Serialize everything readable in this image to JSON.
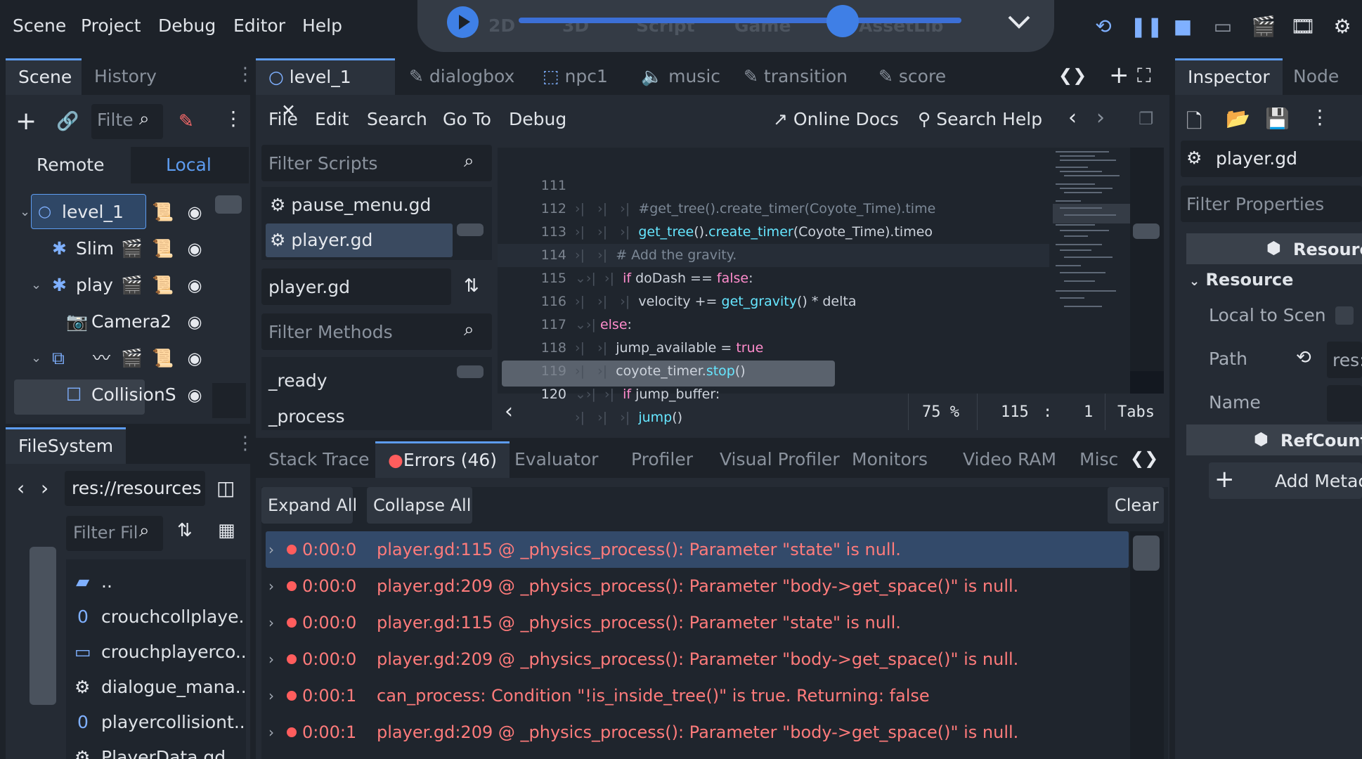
{
  "menu": [
    "Scene",
    "Project",
    "Debug",
    "Editor",
    "Help"
  ],
  "run_bar": {
    "tabs": [
      "2D",
      "3D",
      "Script",
      "Game",
      "AssetLib"
    ]
  },
  "scene_dock": {
    "tabs": [
      "Scene",
      "History"
    ],
    "filter_placeholder": "Filte",
    "remote_label": "Remote",
    "local_label": "Local",
    "nodes": [
      {
        "label": "level_1"
      },
      {
        "label": "Slim"
      },
      {
        "label": "play"
      },
      {
        "label": "Camera2"
      },
      {
        "label": ""
      },
      {
        "label": "CollisionS"
      }
    ]
  },
  "filesystem": {
    "title": "FileSystem",
    "path": "res://resources",
    "filter_placeholder": "Filter Fil",
    "items": [
      "..",
      "crouchcollplaye...",
      "crouchplayerco...",
      "dialogue_mana...",
      "playercollisiont...",
      "PlayerData.gd"
    ]
  },
  "editor_tabs": [
    "level_1",
    "dialogbox",
    "npc1",
    "music",
    "transition",
    "score"
  ],
  "script_menu": [
    "File",
    "Edit",
    "Search",
    "Go To",
    "Debug"
  ],
  "online_docs": "Online Docs",
  "search_help": "Search Help",
  "filter_scripts_placeholder": "Filter Scripts",
  "scripts": [
    "pause_menu.gd",
    "player.gd"
  ],
  "current_script": "player.gd",
  "filter_methods_placeholder": "Filter Methods",
  "methods": [
    "_ready",
    "_process"
  ],
  "code_lines": [
    {
      "n": "111"
    },
    {
      "n": "112"
    },
    {
      "n": "113"
    },
    {
      "n": "114"
    },
    {
      "n": "115"
    },
    {
      "n": "116"
    },
    {
      "n": "117"
    },
    {
      "n": "118"
    },
    {
      "n": "119"
    },
    {
      "n": "120"
    }
  ],
  "status": {
    "zoom": "75 %",
    "line": "115",
    "sep": ":",
    "col": "1",
    "indent": "Tabs"
  },
  "bottom_tabs": [
    "Stack Trace",
    "Errors (46)",
    "Evaluator",
    "Profiler",
    "Visual Profiler",
    "Monitors",
    "Video RAM",
    "Misc"
  ],
  "expand_all": "Expand All",
  "collapse_all": "Collapse All",
  "clear": "Clear",
  "errors": [
    {
      "time": "0:00:0",
      "msg": "player.gd:115 @ _physics_process(): Parameter \"state\" is null."
    },
    {
      "time": "0:00:0",
      "msg": "player.gd:209 @ _physics_process(): Parameter \"body->get_space()\" is null."
    },
    {
      "time": "0:00:0",
      "msg": "player.gd:115 @ _physics_process(): Parameter \"state\" is null."
    },
    {
      "time": "0:00:0",
      "msg": "player.gd:209 @ _physics_process(): Parameter \"body->get_space()\" is null."
    },
    {
      "time": "0:00:1",
      "msg": "can_process: Condition \"!is_inside_tree()\" is true. Returning: false"
    },
    {
      "time": "0:00:1",
      "msg": "player.gd:209 @ _physics_process(): Parameter \"body->get_space()\" is null."
    }
  ],
  "inspector": {
    "tabs": [
      "Inspector",
      "Node"
    ],
    "object": "player.gd",
    "filter_placeholder": "Filter Properties",
    "section": "Resourc",
    "group": "Resource",
    "props": [
      "Local to Scen",
      "Path",
      "Name"
    ],
    "path_value": "res:",
    "refcount": "RefCount",
    "add_meta": "Add Metac"
  },
  "colors": {
    "accent": "#5d9cf0",
    "error": "#ff7b7b",
    "bg": "#1d2229",
    "panel": "#252b34"
  }
}
